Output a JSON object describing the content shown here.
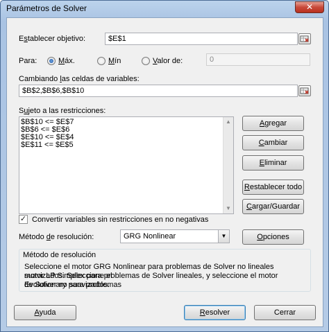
{
  "window": {
    "title": "Parámetros de Solver",
    "close_glyph": "✕"
  },
  "objective": {
    "label_pre": "E",
    "label_u": "s",
    "label_post": "tablecer objetivo:",
    "value": "$E$1",
    "ref_icon": "range-select-icon"
  },
  "to": {
    "label": "Para:",
    "max": {
      "label_pre": "",
      "label_u": "M",
      "label_post": "áx.",
      "selected": true
    },
    "min": {
      "label_pre": "",
      "label_u": "M",
      "label_post": "ín",
      "selected": false
    },
    "value_of": {
      "label_pre": "",
      "label_u": "V",
      "label_post": "alor de:",
      "selected": false,
      "value": "0"
    }
  },
  "changing": {
    "label_pre": "Cambiando ",
    "label_u": "l",
    "label_post": "as celdas de variables:",
    "value": "$B$2,$B$6,$B$10",
    "ref_icon": "range-select-icon"
  },
  "constraints": {
    "label_pre": "S",
    "label_u": "u",
    "label_post": "jeto a las restricciones:",
    "items": [
      "$B$10 <= $E$7",
      "$B$6 <= $E$6",
      "$E$10 <= $E$4",
      "$E$11 <= $E$5"
    ]
  },
  "buttons": {
    "add": {
      "pre": "",
      "u": "A",
      "post": "gregar"
    },
    "change": {
      "pre": "",
      "u": "C",
      "post": "ambiar"
    },
    "delete": {
      "pre": "",
      "u": "E",
      "post": "liminar"
    },
    "reset": {
      "pre": "",
      "u": "R",
      "post": "establecer todo"
    },
    "load_save": {
      "pre": "",
      "u": "C",
      "post": "argar/Guardar"
    },
    "options": {
      "pre": "",
      "u": "O",
      "post": "pciones"
    },
    "help": {
      "pre": "",
      "u": "A",
      "post": "yuda"
    },
    "solve": {
      "pre": "",
      "u": "R",
      "post": "esolver"
    },
    "close": {
      "label": "Cerrar"
    }
  },
  "nonneg": {
    "checked": true,
    "check_glyph": "✓",
    "label_pre": "Convertir variables sin restricciones en no ne",
    "label_u": "g",
    "label_post": "ativas"
  },
  "method": {
    "label_pre": "Método ",
    "label_u": "d",
    "label_post": "e resolución:",
    "selected": "GRG Nonlinear",
    "dropdown_glyph": "▼"
  },
  "method_group": {
    "title": "Método de resolución",
    "description_lines": [
      "Seleccione el motor GRG Nonlinear para problemas de Solver no lineales suavizados. Seleccione el",
      "motor LP Simplex para problemas de Solver lineales, y seleccione el motor Evolutionary para problemas",
      "de Solver no suavizados."
    ]
  },
  "scroll": {
    "up_glyph": "▲",
    "down_glyph": "▼"
  }
}
